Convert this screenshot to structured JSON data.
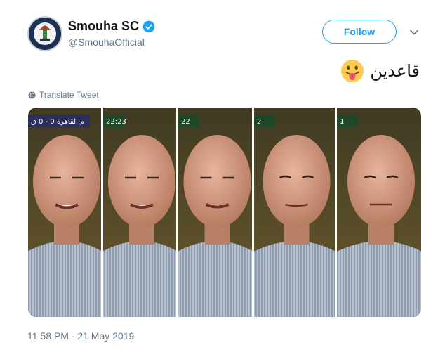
{
  "user": {
    "display_name": "Smouha SC",
    "handle": "@SmouhaOfficial",
    "verified": true
  },
  "actions": {
    "follow_label": "Follow"
  },
  "tweet": {
    "text": "قاعدين",
    "emoji": "face-with-tongue",
    "translate_label": "Translate Tweet",
    "timestamp": "11:58 PM - 21 May 2019"
  },
  "media": {
    "panels": [
      {
        "overlay": "م القاهرة 0 - 0 ق"
      },
      {
        "overlay": "22:23"
      },
      {
        "overlay": "22"
      },
      {
        "overlay": "2"
      },
      {
        "overlay": "1"
      }
    ]
  },
  "colors": {
    "accent": "#1da1f2",
    "secondary_text": "#657786",
    "divider": "#e6ecf0"
  }
}
